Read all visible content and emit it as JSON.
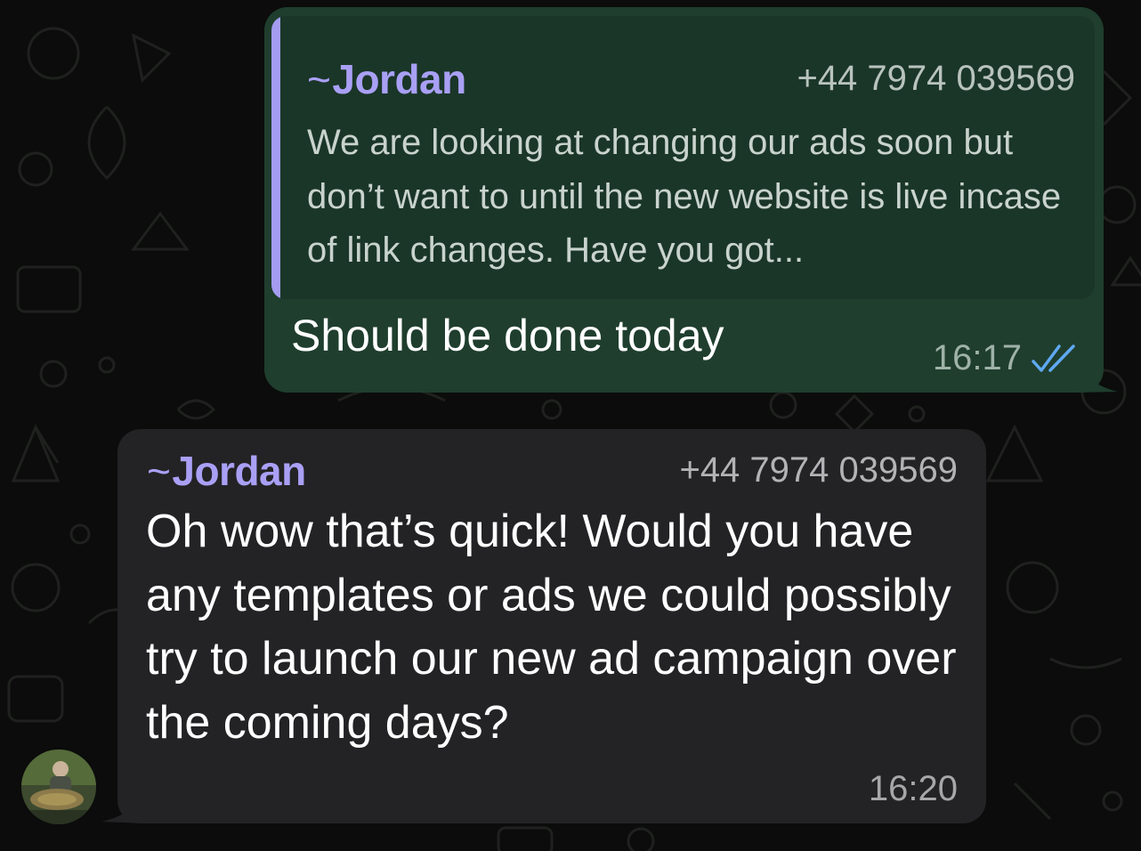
{
  "messages": {
    "outgoing": {
      "quote": {
        "sender_name": "Jordan",
        "sender_phone": "+44 7974 039569",
        "text": "We are looking at changing our ads soon but don’t want to until the new website is live incase of link changes. Have you got..."
      },
      "text": "Should be done today",
      "time": "16:17",
      "status_icon": "double-check-read"
    },
    "incoming": {
      "sender_name": "Jordan",
      "sender_phone": "+44 7974 039569",
      "text": "Oh wow that’s quick! Would you have any templates or ads we could possibly try to launch our new ad campaign over the coming days?",
      "time": "16:20"
    }
  },
  "colors": {
    "background": "#0b0c0b",
    "outgoing_bubble": "#1f3e2e",
    "incoming_bubble": "#232325",
    "name_accent": "#a9a0f5",
    "read_check": "#5fa9f2"
  }
}
